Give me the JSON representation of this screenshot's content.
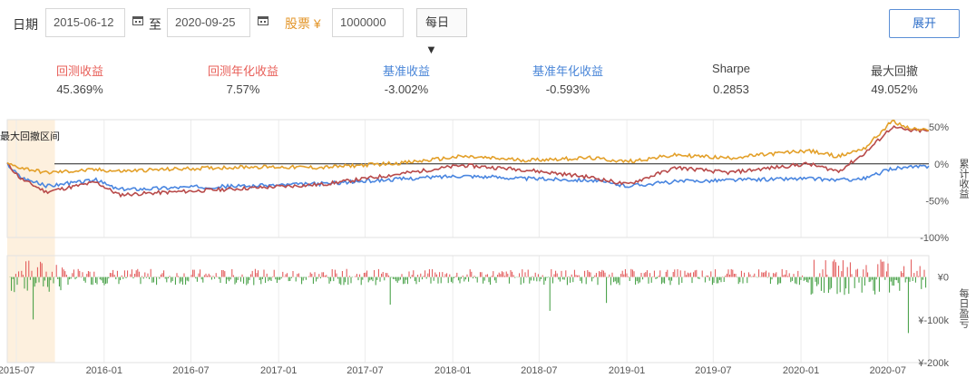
{
  "toolbar": {
    "date_label": "日期",
    "start_date": "2015-06-12",
    "to_label": "至",
    "end_date": "2020-09-25",
    "stock_label": "股票 ¥",
    "capital": "1000000",
    "frequency": "每日▼",
    "expand_label": "展开"
  },
  "metrics": [
    {
      "label": "回测收益",
      "value": "45.369%"
    },
    {
      "label": "回测年化收益",
      "value": "7.57%"
    },
    {
      "label": "基准收益",
      "value": "-3.002%"
    },
    {
      "label": "基准年化收益",
      "value": "-0.593%"
    },
    {
      "label": "Sharpe",
      "value": "0.2853"
    },
    {
      "label": "最大回撤",
      "value": "49.052%"
    }
  ],
  "colors": {
    "strategy": "#b84a4a",
    "benchmark": "#e3a02a",
    "excess": "#4a86e0",
    "drawdown_band": "#fdf0de",
    "gain_bar": "#e05050",
    "loss_bar": "#3a9a3a"
  },
  "chart_data": [
    {
      "type": "line",
      "annotation": "最大回撤区间",
      "ylabel": "累计收益",
      "y_ticks": [
        "50%",
        "0%",
        "-50%",
        "-100%"
      ],
      "ylim": [
        -100,
        60
      ],
      "x_range": [
        "2015-06-12",
        "2020-09-25"
      ],
      "grid": true,
      "series": [
        {
          "values": [
            {
              "x": "2015-06-12",
              "y": 0
            },
            {
              "x": "2015-07-10",
              "y": -20
            },
            {
              "x": "2015-09-01",
              "y": -38
            },
            {
              "x": "2015-12-15",
              "y": -25
            },
            {
              "x": "2016-02-01",
              "y": -42
            },
            {
              "x": "2016-06-01",
              "y": -38
            },
            {
              "x": "2016-11-01",
              "y": -33
            },
            {
              "x": "2017-04-01",
              "y": -28
            },
            {
              "x": "2017-10-01",
              "y": -12
            },
            {
              "x": "2018-01-20",
              "y": -2
            },
            {
              "x": "2018-06-01",
              "y": -8
            },
            {
              "x": "2018-10-15",
              "y": -18
            },
            {
              "x": "2019-01-01",
              "y": -28
            },
            {
              "x": "2019-04-15",
              "y": -5
            },
            {
              "x": "2019-08-01",
              "y": -12
            },
            {
              "x": "2020-01-15",
              "y": 0
            },
            {
              "x": "2020-03-20",
              "y": -10
            },
            {
              "x": "2020-05-15",
              "y": 15
            },
            {
              "x": "2020-07-10",
              "y": 50
            },
            {
              "x": "2020-08-15",
              "y": 45
            },
            {
              "x": "2020-09-25",
              "y": 45
            }
          ]
        },
        {
          "values": [
            {
              "x": "2015-06-12",
              "y": 0
            },
            {
              "x": "2015-07-10",
              "y": -5
            },
            {
              "x": "2015-09-01",
              "y": -12
            },
            {
              "x": "2015-12-15",
              "y": -8
            },
            {
              "x": "2016-02-01",
              "y": -10
            },
            {
              "x": "2016-06-01",
              "y": -7
            },
            {
              "x": "2016-11-01",
              "y": -4
            },
            {
              "x": "2017-04-01",
              "y": -5
            },
            {
              "x": "2017-10-01",
              "y": 2
            },
            {
              "x": "2018-01-20",
              "y": 10
            },
            {
              "x": "2018-06-01",
              "y": 5
            },
            {
              "x": "2018-10-15",
              "y": 8
            },
            {
              "x": "2019-01-01",
              "y": 3
            },
            {
              "x": "2019-04-15",
              "y": 12
            },
            {
              "x": "2019-08-01",
              "y": 8
            },
            {
              "x": "2020-01-15",
              "y": 18
            },
            {
              "x": "2020-03-20",
              "y": 10
            },
            {
              "x": "2020-05-15",
              "y": 22
            },
            {
              "x": "2020-07-10",
              "y": 58
            },
            {
              "x": "2020-08-15",
              "y": 48
            },
            {
              "x": "2020-09-25",
              "y": 45
            }
          ]
        },
        {
          "values": [
            {
              "x": "2015-06-12",
              "y": 0
            },
            {
              "x": "2015-07-10",
              "y": -18
            },
            {
              "x": "2015-09-01",
              "y": -30
            },
            {
              "x": "2015-12-15",
              "y": -22
            },
            {
              "x": "2016-02-01",
              "y": -35
            },
            {
              "x": "2016-06-01",
              "y": -32
            },
            {
              "x": "2016-11-01",
              "y": -30
            },
            {
              "x": "2017-04-01",
              "y": -27
            },
            {
              "x": "2017-10-01",
              "y": -20
            },
            {
              "x": "2018-01-20",
              "y": -16
            },
            {
              "x": "2018-06-01",
              "y": -20
            },
            {
              "x": "2018-10-15",
              "y": -22
            },
            {
              "x": "2019-01-01",
              "y": -30
            },
            {
              "x": "2019-04-15",
              "y": -24
            },
            {
              "x": "2019-08-01",
              "y": -22
            },
            {
              "x": "2020-01-15",
              "y": -20
            },
            {
              "x": "2020-03-20",
              "y": -22
            },
            {
              "x": "2020-05-15",
              "y": -20
            },
            {
              "x": "2020-07-10",
              "y": -6
            },
            {
              "x": "2020-08-15",
              "y": -5
            },
            {
              "x": "2020-09-25",
              "y": -3
            }
          ]
        }
      ],
      "drawdown_period": [
        "2015-06-12",
        "2015-09-20"
      ]
    },
    {
      "type": "bar",
      "ylabel": "每日盈亏",
      "y_ticks": [
        "¥0",
        "¥-100k",
        "¥-200k"
      ],
      "ylim": [
        -200000,
        50000
      ],
      "x_ticks": [
        "2015-07",
        "2016-01",
        "2016-07",
        "2017-01",
        "2017-07",
        "2018-01",
        "2018-07",
        "2019-01",
        "2019-07",
        "2020-01",
        "2020-07"
      ]
    }
  ]
}
